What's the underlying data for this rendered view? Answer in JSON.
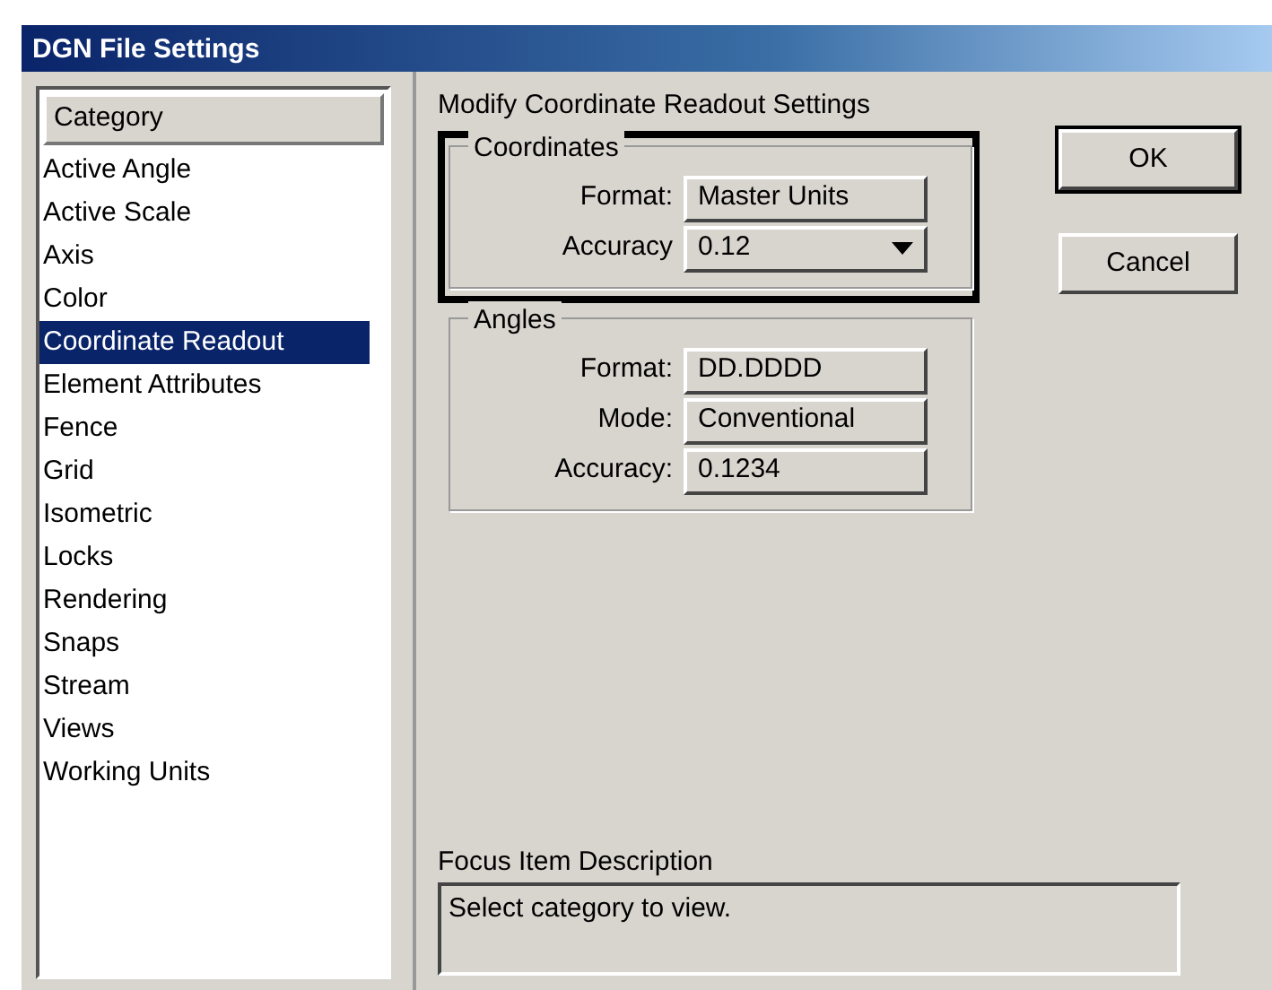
{
  "window": {
    "title": "DGN File Settings"
  },
  "category_list": {
    "header": "Category",
    "items": [
      {
        "label": "Active Angle",
        "selected": false
      },
      {
        "label": "Active Scale",
        "selected": false
      },
      {
        "label": "Axis",
        "selected": false
      },
      {
        "label": "Color",
        "selected": false
      },
      {
        "label": "Coordinate Readout",
        "selected": true
      },
      {
        "label": "Element Attributes",
        "selected": false
      },
      {
        "label": "Fence",
        "selected": false
      },
      {
        "label": "Grid",
        "selected": false
      },
      {
        "label": "Isometric",
        "selected": false
      },
      {
        "label": "Locks",
        "selected": false
      },
      {
        "label": "Rendering",
        "selected": false
      },
      {
        "label": "Snaps",
        "selected": false
      },
      {
        "label": "Stream",
        "selected": false
      },
      {
        "label": "Views",
        "selected": false
      },
      {
        "label": "Working Units",
        "selected": false
      }
    ]
  },
  "panel_title": "Modify Coordinate Readout Settings",
  "groups": [
    {
      "title": "Coordinates",
      "highlighted": true,
      "fields": [
        {
          "label": "Format:",
          "value": "Master Units",
          "kind": "button"
        },
        {
          "label": "Accuracy",
          "value": "0.12",
          "kind": "dropdown"
        }
      ]
    },
    {
      "title": "Angles",
      "highlighted": false,
      "fields": [
        {
          "label": "Format:",
          "value": "DD.DDDD",
          "kind": "button"
        },
        {
          "label": "Mode:",
          "value": "Conventional",
          "kind": "button"
        },
        {
          "label": "Accuracy:",
          "value": "0.1234",
          "kind": "button"
        }
      ]
    }
  ],
  "buttons": [
    {
      "label": "OK",
      "default": true
    },
    {
      "label": "Cancel",
      "default": false
    }
  ],
  "description": {
    "label": "Focus Item Description",
    "text": "Select category to view."
  }
}
